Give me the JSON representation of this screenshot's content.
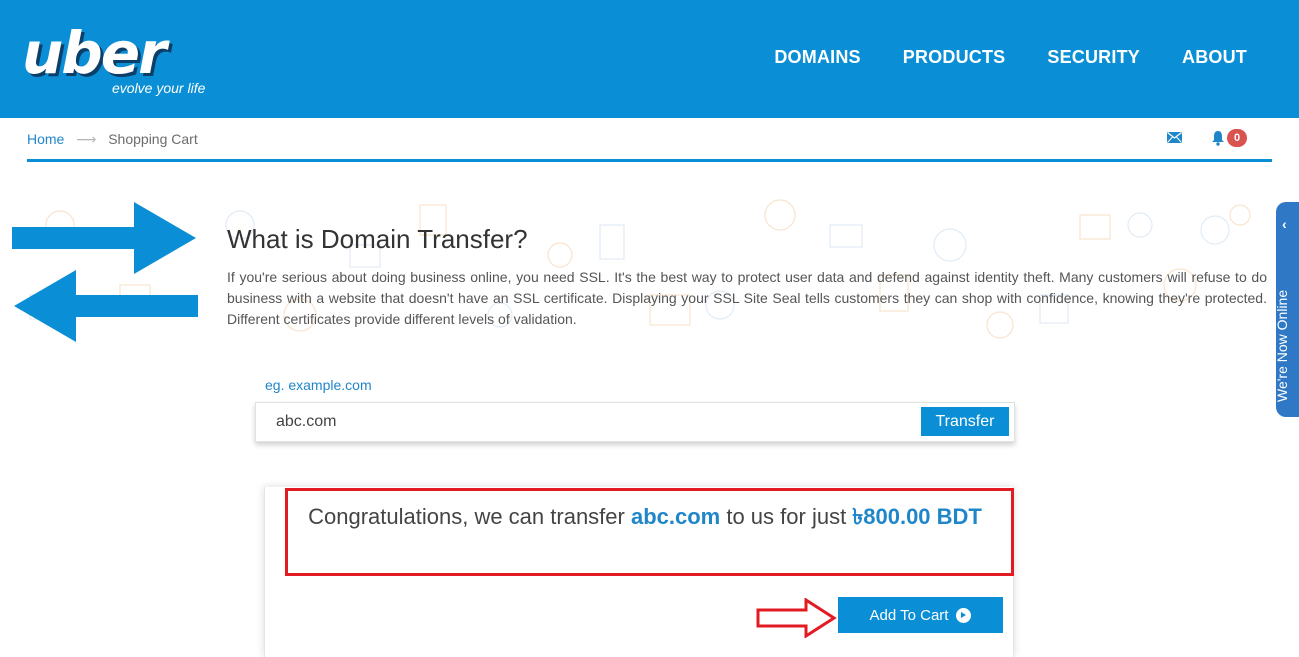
{
  "brand": {
    "name": "uber",
    "tagline": "evolve your life",
    "color": "#0a8fd6"
  },
  "nav": {
    "items": [
      "DOMAINS",
      "PRODUCTS",
      "SECURITY",
      "ABOUT"
    ]
  },
  "breadcrumb": {
    "home": "Home",
    "current": "Shopping Cart"
  },
  "header_icons": {
    "mail": "envelope-icon",
    "notifications": "bell-icon",
    "notification_count": "0"
  },
  "intro": {
    "title": "What is Domain Transfer?",
    "description": "If you're serious about doing business online, you need SSL. It's the best way to protect user data and defend against identity theft. Many customers will refuse to do business with a website that doesn't have an SSL certificate. Displaying your SSL Site Seal tells customers they can shop with confidence, knowing they're protected. Different certificates provide different levels of validation."
  },
  "search": {
    "example": "eg. example.com",
    "value": "abc.com",
    "button": "Transfer"
  },
  "result": {
    "prefix": "Congratulations, we can transfer ",
    "domain": "abc.com",
    "middle": " to us for just ",
    "price": "৳800.00 BDT",
    "highlight_color": "#e21b23"
  },
  "cart": {
    "button": "Add To Cart",
    "icon": "circle-arrow-right-icon"
  },
  "live_chat": {
    "label": "We're Now Online",
    "icon": "chevron-left-icon"
  }
}
